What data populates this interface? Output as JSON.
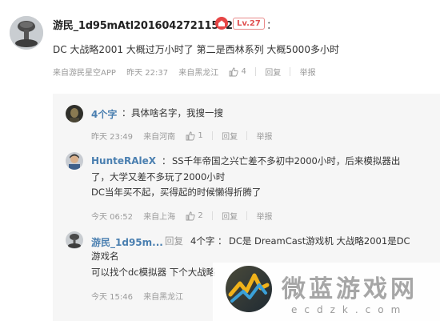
{
  "main_comment": {
    "username": "游民_1d95mAtl20160427211532",
    "level": "Lv.27",
    "colon": "：",
    "text": "DC 大战略2001  大概过万小时了  第二是西林系列  大概5000多小时",
    "source": "来自游民星空APP",
    "time": "昨天 22:37",
    "location": "来自黑龙江",
    "likes": "4",
    "reply_label": "回复",
    "report_label": "举报"
  },
  "replies": [
    {
      "username": "4个字",
      "colon": "：",
      "lines": [
        "具体啥名字，我搜一搜"
      ],
      "time": "昨天 23:49",
      "location": "来自河南",
      "likes": "1",
      "reply_label": "回复",
      "report_label": "举报"
    },
    {
      "username": "HunteRAleX",
      "colon": "：",
      "lines": [
        "SS千年帝国之兴亡差不多初中2000小时，后来模拟器出",
        "了，大学又差不多玩了2000小时",
        "DC当年买不起，买得起的时候懒得折腾了"
      ],
      "time": "今天 06:52",
      "location": "来自上海",
      "likes": "2",
      "reply_label": "回复",
      "report_label": "举报"
    },
    {
      "username": "游民_1d95m...",
      "reply_to_label": "回复",
      "reply_to_user": "4个字",
      "colon": "：",
      "lines": [
        "DC是 DreamCast游戏机  大战略2001是DC",
        "游戏名",
        "可以找个dc模拟器  下个大战略"
      ],
      "time": "今天 15:46",
      "location": "来自黑龙江"
    }
  ],
  "watermark": {
    "title": "微蓝游戏网",
    "subtitle": "ecdzk.com"
  },
  "colors": {
    "username_blue": "#4a7fb0",
    "level_red": "#e05050",
    "meta_gray": "#9a9a9a",
    "reply_bg": "#f6f6f6"
  }
}
